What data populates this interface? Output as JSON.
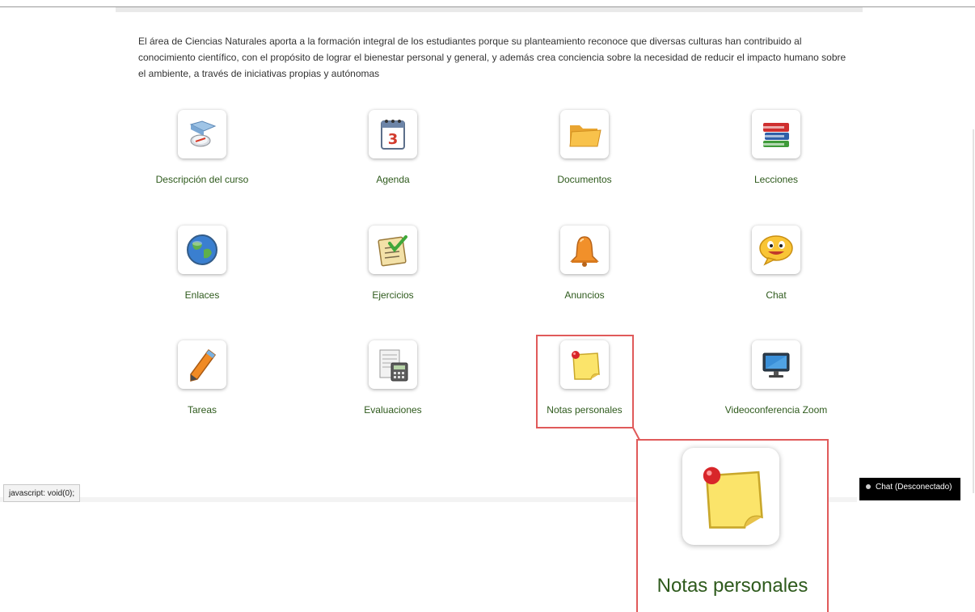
{
  "description": "El área de Ciencias Naturales aporta a la formación integral de los estudiantes porque su planteamiento reconoce que diversas culturas han contribuido al conocimiento científico, con el propósito de lograr el bienestar personal y general, y además crea conciencia sobre la necesidad de reducir el impacto humano sobre el ambiente, a través de iniciativas propias y autónomas",
  "tools": [
    {
      "label": "Descripción del curso",
      "icon": "compass-map-icon"
    },
    {
      "label": "Agenda",
      "icon": "calendar-icon"
    },
    {
      "label": "Documentos",
      "icon": "folder-icon"
    },
    {
      "label": "Lecciones",
      "icon": "books-icon"
    },
    {
      "label": "Enlaces",
      "icon": "globe-icon"
    },
    {
      "label": "Ejercicios",
      "icon": "checklist-icon"
    },
    {
      "label": "Anuncios",
      "icon": "bell-icon"
    },
    {
      "label": "Chat",
      "icon": "smiley-chat-icon"
    },
    {
      "label": "Tareas",
      "icon": "pencil-icon"
    },
    {
      "label": "Evaluaciones",
      "icon": "calculator-sheet-icon"
    },
    {
      "label": "Notas personales",
      "icon": "sticky-note-icon"
    },
    {
      "label": "Videoconferencia Zoom",
      "icon": "monitor-icon"
    }
  ],
  "zoom_callout": {
    "label": "Notas personales",
    "icon": "sticky-note-icon"
  },
  "status_bar": {
    "text": "javascript: void(0);"
  },
  "chat_widget": {
    "label": "Chat (Desconectado)",
    "status": "offline"
  },
  "colors": {
    "link_green": "#2e5a1c",
    "highlight_red": "#e05a5a",
    "chat_bg": "#000000"
  }
}
